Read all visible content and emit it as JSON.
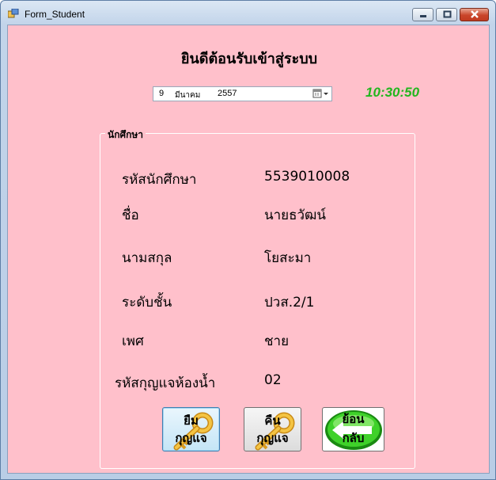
{
  "window": {
    "title": "Form_Student"
  },
  "header": {
    "welcome": "ยินดีต้อนรับเข้าสู่ระบบ"
  },
  "date_picker": {
    "day": "9",
    "month": "มีนาคม",
    "year": "2557"
  },
  "clock": {
    "time": "10:30:50",
    "color": "#22b61e"
  },
  "student_group": {
    "title": "นักศึกษา",
    "fields": [
      {
        "label": "รหัสนักศึกษา",
        "value": "5539010008"
      },
      {
        "label": "ชื่อ",
        "value": "นายธวัฒน์"
      },
      {
        "label": "นามสกุล",
        "value": "โยสะมา"
      },
      {
        "label": "ระดับชั้น",
        "value": "ปวส.2/1"
      },
      {
        "label": "เพศ",
        "value": "ชาย"
      },
      {
        "label": "รหัสกุญแจห้องน้ำ",
        "value": "02"
      }
    ]
  },
  "buttons": {
    "borrow": {
      "line1": "ยืม",
      "line2": "กุญแจ",
      "icon": "key-icon"
    },
    "return": {
      "line1": "คืน",
      "line2": "กุญแจ",
      "icon": "key-icon"
    },
    "back": {
      "line1": "ย้อน",
      "line2": "กลับ",
      "icon": "back-arrow-icon"
    }
  },
  "colors": {
    "client_background": "#ffc0cb",
    "titlebar": "#c2d4ea"
  }
}
